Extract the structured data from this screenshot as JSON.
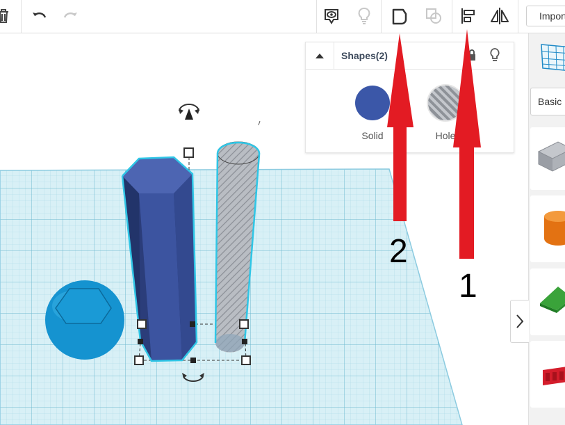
{
  "toolbar": {
    "import_label": "Import",
    "icons": [
      "trash-icon",
      "undo-icon",
      "redo-icon",
      "show-all-icon",
      "light-bulb-icon",
      "group-icon",
      "ungroup-icon",
      "align-icon",
      "mirror-icon"
    ]
  },
  "shapes_panel": {
    "title": "Shapes(2)",
    "solid_label": "Solid",
    "hole_label": "Hole",
    "solid_color": "#3b57a8"
  },
  "right_sidebar": {
    "category_label": "Basic"
  },
  "annotations": {
    "label_1": "1",
    "label_2": "2",
    "arrow_color": "#e31b23"
  }
}
